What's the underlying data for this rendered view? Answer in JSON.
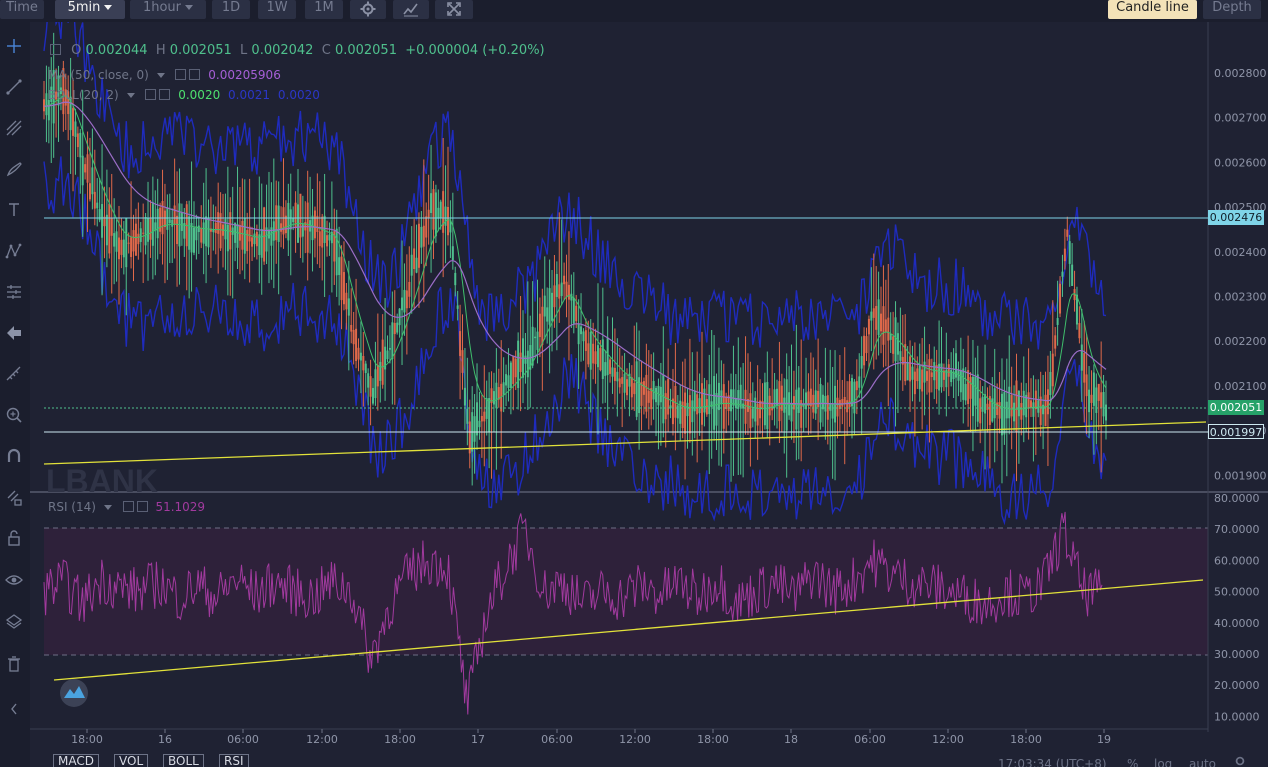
{
  "toolbar": {
    "time_label": "Time",
    "interval_label": "5min",
    "hour_label": "1hour",
    "d1_label": "1D",
    "w1_label": "1W",
    "m1_label": "1M",
    "candle_line_label": "Candle line",
    "depth_label": "Depth",
    "icons": [
      "gear-icon",
      "chart-type-icon",
      "fullscreen-icon"
    ]
  },
  "sidebar": {
    "icons": [
      "crosshair-icon",
      "trend-line-icon",
      "pitchfork-icon",
      "brush-icon",
      "text-icon",
      "pattern-icon",
      "measure-icon",
      "back-arrow-icon",
      "ruler-icon",
      "zoom-in-icon",
      "magnet-icon",
      "lock-pencil-icon",
      "lock-icon",
      "eye-icon",
      "layers-icon",
      "trash-icon"
    ]
  },
  "legend": {
    "o_key": "O",
    "o_val": "0.002044",
    "h_key": "H",
    "h_val": "0.002051",
    "l_key": "L",
    "l_val": "0.002042",
    "c_key": "C",
    "c_val": "0.002051",
    "change": "+0.000004 (+0.20%)",
    "ma_label": "MA (50, close, 0)",
    "ma_val": "0.00205906",
    "boll_label": "BOLL(20, 2)",
    "boll_mid": "0.0020",
    "boll_upper": "0.0021",
    "boll_lower": "0.0020",
    "rsi_label": "RSI (14)",
    "rsi_val": "51.1029"
  },
  "watermark": "LBANK",
  "price_axis": [
    "0.002800",
    "0.002700",
    "0.002600",
    "0.002500",
    "0.002400",
    "0.002300",
    "0.002200",
    "0.002100",
    "0.002000",
    "0.001900"
  ],
  "rsi_axis": [
    "80.0000",
    "70.0000",
    "60.0000",
    "50.0000",
    "40.0000",
    "30.0000",
    "20.0000",
    "10.0000"
  ],
  "time_axis": [
    "18:00",
    "16",
    "06:00",
    "12:00",
    "18:00",
    "17",
    "06:00",
    "12:00",
    "18:00",
    "18",
    "06:00",
    "12:00",
    "18:00",
    "19"
  ],
  "price_tags": {
    "resistance": "0.002476",
    "current": "0.002051",
    "support": "0.001997"
  },
  "colors": {
    "up": "#4fc08d",
    "down": "#e0694a",
    "boll": "#1f2bbd",
    "ma": "#9b6dc7",
    "rsi": "#a13a9e",
    "trendline": "#e2e23a",
    "hline": "#7fd4e8"
  },
  "chart_data": {
    "type": "line",
    "price_ylim": [
      0.00187,
      0.00284
    ],
    "rsi_ylim": [
      8,
      84
    ],
    "horizontal_levels": [
      0.002476,
      0.002051,
      0.001997
    ],
    "series": [
      {
        "name": "price",
        "values": [
          0.00268,
          0.00272,
          0.00256,
          0.00245,
          0.00238,
          0.00241,
          0.00244,
          0.00243,
          0.00242,
          0.00242,
          0.00241,
          0.0024,
          0.00243,
          0.00244,
          0.00242,
          0.0024,
          0.0022,
          0.00208,
          0.00218,
          0.00232,
          0.00246,
          0.00246,
          0.00198,
          0.00205,
          0.0021,
          0.00215,
          0.00225,
          0.00232,
          0.00218,
          0.00214,
          0.0021,
          0.00208,
          0.00206,
          0.00204,
          0.00205,
          0.00206,
          0.00205,
          0.00204,
          0.00206,
          0.00205,
          0.00206,
          0.00205,
          0.00207,
          0.00226,
          0.00218,
          0.00212,
          0.00212,
          0.00212,
          0.00208,
          0.00204,
          0.00204,
          0.00205,
          0.00205,
          0.00242,
          0.00208,
          0.00205
        ]
      },
      {
        "name": "rsi",
        "values": [
          52,
          55,
          48,
          56,
          53,
          52,
          55,
          50,
          54,
          50,
          56,
          51,
          55,
          52,
          50,
          55,
          52,
          30,
          48,
          58,
          62,
          60,
          15,
          45,
          60,
          72,
          52,
          55,
          48,
          52,
          50,
          54,
          51,
          55,
          50,
          56,
          48,
          52,
          55,
          50,
          58,
          52,
          55,
          62,
          58,
          55,
          54,
          52,
          50,
          48,
          52,
          50,
          55,
          72,
          52,
          51
        ]
      }
    ],
    "trendlines": {
      "price": [
        [
          0,
          0.001953
        ],
        [
          1,
          0.002013
        ]
      ],
      "rsi": [
        [
          0,
          22
        ],
        [
          1,
          53.5
        ]
      ]
    }
  },
  "bottom": {
    "tabs": [
      "MACD",
      "VOL",
      "BOLL",
      "RSI"
    ],
    "timestamp": "17:03:34 (UTC+8)",
    "percent": "%",
    "log": "log",
    "auto": "auto"
  }
}
